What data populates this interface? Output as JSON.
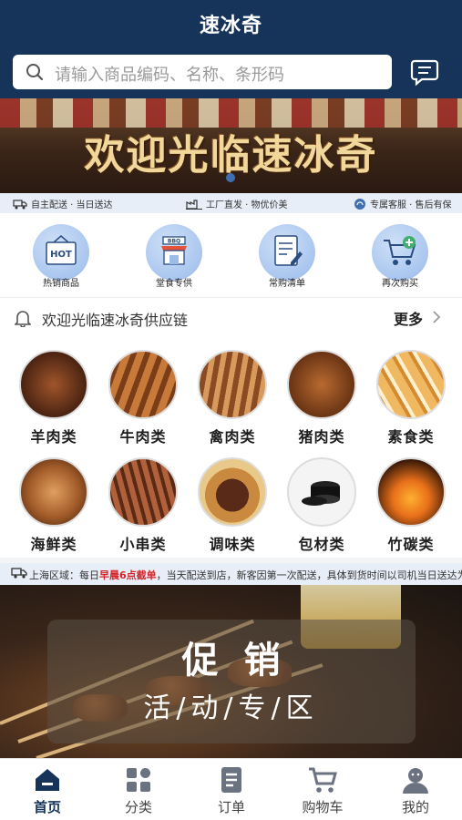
{
  "header": {
    "title": "速冰奇",
    "search_placeholder": "请输入商品编码、名称、条形码"
  },
  "banner": {
    "text": "欢迎光临速冰奇"
  },
  "service_bar": {
    "items": [
      "自主配送 · 当日送达",
      "工厂直发 · 物优价美",
      "专属客服 · 售后有保"
    ]
  },
  "quick_links": [
    {
      "label": "热销商品",
      "icon": "hot-box-icon",
      "badge": "HOT"
    },
    {
      "label": "堂食专供",
      "icon": "bbq-shop-icon",
      "badge": "BBQ"
    },
    {
      "label": "常购清单",
      "icon": "checklist-icon"
    },
    {
      "label": "再次购买",
      "icon": "cart-plus-icon"
    }
  ],
  "notice": {
    "text": "欢迎光临速冰奇供应链",
    "more_label": "更多"
  },
  "categories": [
    {
      "label": "羊肉类"
    },
    {
      "label": "牛肉类"
    },
    {
      "label": "禽肉类"
    },
    {
      "label": "猪肉类"
    },
    {
      "label": "素食类"
    },
    {
      "label": "海鲜类"
    },
    {
      "label": "小串类"
    },
    {
      "label": "调味类"
    },
    {
      "label": "包材类"
    },
    {
      "label": "竹碳类"
    }
  ],
  "delivery": {
    "prefix": "上海区域：每日",
    "highlight": "早晨6点截单",
    "suffix": "，当天配送到店，新客因第一次配送，具体到货时间以司机当日送达为准"
  },
  "promo": {
    "title": "促销",
    "subtitle": "活/动/专/区"
  },
  "tabbar": {
    "items": [
      {
        "label": "首页",
        "icon": "home-icon",
        "active": true
      },
      {
        "label": "分类",
        "icon": "category-grid-icon",
        "active": false
      },
      {
        "label": "订单",
        "icon": "order-list-icon",
        "active": false
      },
      {
        "label": "购物车",
        "icon": "shopping-cart-icon",
        "active": false
      },
      {
        "label": "我的",
        "icon": "user-profile-icon",
        "active": false
      }
    ]
  },
  "colors": {
    "header_bg": "#16345a",
    "accent_red": "#d4242a",
    "banner_text": "#f2d79a"
  }
}
